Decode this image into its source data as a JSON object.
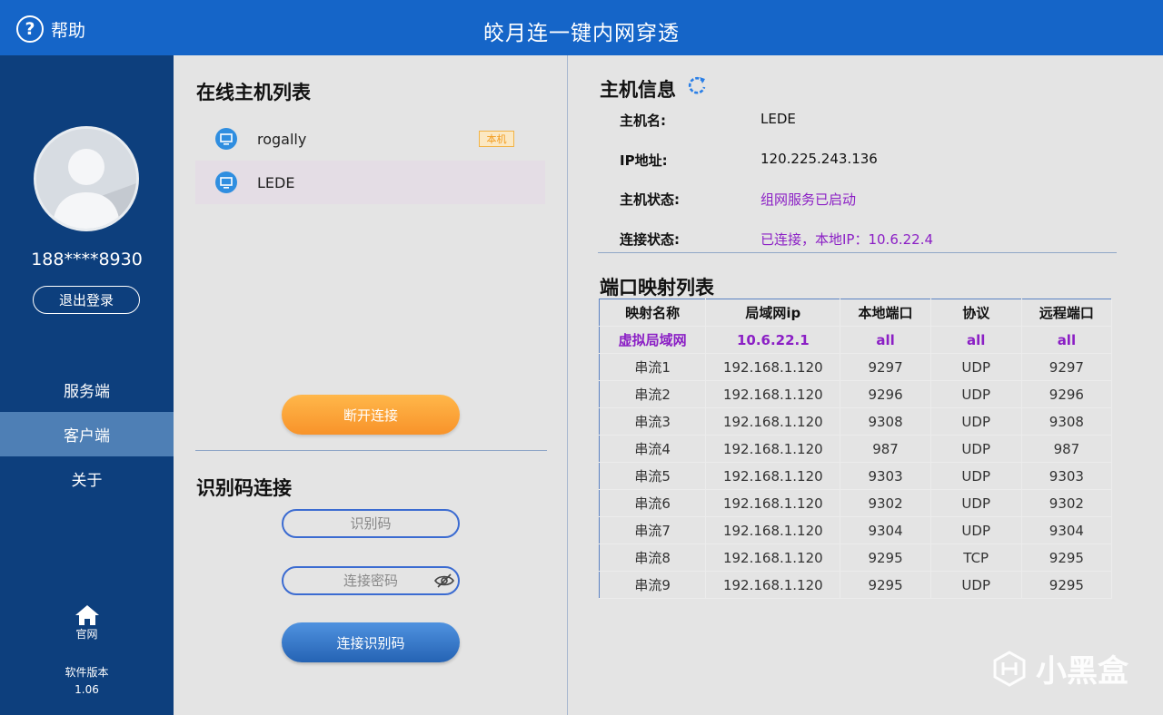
{
  "titlebar": {
    "help_label": "帮助",
    "title": "皎月连一键内网穿透"
  },
  "sidebar": {
    "phone": "188****8930",
    "logout_label": "退出登录",
    "nav": [
      {
        "label": "服务端",
        "active": false
      },
      {
        "label": "客户端",
        "active": true
      },
      {
        "label": "关于",
        "active": false
      }
    ],
    "home_label": "官网",
    "version_label": "软件版本",
    "version_number": "1.06"
  },
  "hosts": {
    "title": "在线主机列表",
    "local_badge": "本机",
    "items": [
      {
        "name": "rogally"
      },
      {
        "name": "LEDE"
      }
    ],
    "disconnect_label": "断开连接"
  },
  "code_connect": {
    "title": "识别码连接",
    "code_placeholder": "识别码",
    "password_placeholder": "连接密码",
    "connect_label": "连接识别码"
  },
  "host_info": {
    "title": "主机信息",
    "name_label": "主机名:",
    "name_value": "LEDE",
    "ip_label": "IP地址:",
    "ip_value": "120.225.243.136",
    "status_label": "主机状态:",
    "status_value": "组网服务已启动",
    "conn_label": "连接状态:",
    "conn_value": "已连接，本地IP：10.6.22.4"
  },
  "port_map": {
    "title": "端口映射列表",
    "headers": [
      "映射名称",
      "局域网ip",
      "本地端口",
      "协议",
      "远程端口"
    ],
    "rows": [
      [
        "虚拟局域网",
        "10.6.22.1",
        "all",
        "all",
        "all"
      ],
      [
        "串流1",
        "192.168.1.120",
        "9297",
        "UDP",
        "9297"
      ],
      [
        "串流2",
        "192.168.1.120",
        "9296",
        "UDP",
        "9296"
      ],
      [
        "串流3",
        "192.168.1.120",
        "9308",
        "UDP",
        "9308"
      ],
      [
        "串流4",
        "192.168.1.120",
        "987",
        "UDP",
        "987"
      ],
      [
        "串流5",
        "192.168.1.120",
        "9303",
        "UDP",
        "9303"
      ],
      [
        "串流6",
        "192.168.1.120",
        "9302",
        "UDP",
        "9302"
      ],
      [
        "串流7",
        "192.168.1.120",
        "9304",
        "UDP",
        "9304"
      ],
      [
        "串流8",
        "192.168.1.120",
        "9295",
        "TCP",
        "9295"
      ],
      [
        "串流9",
        "192.168.1.120",
        "9295",
        "UDP",
        "9295"
      ]
    ]
  },
  "watermark": "小黑盒",
  "colors": {
    "primary": "#1565c8",
    "sidebar": "#0d3f7d",
    "accent_orange": "#f8932a",
    "status_purple": "#8b1fc5"
  }
}
